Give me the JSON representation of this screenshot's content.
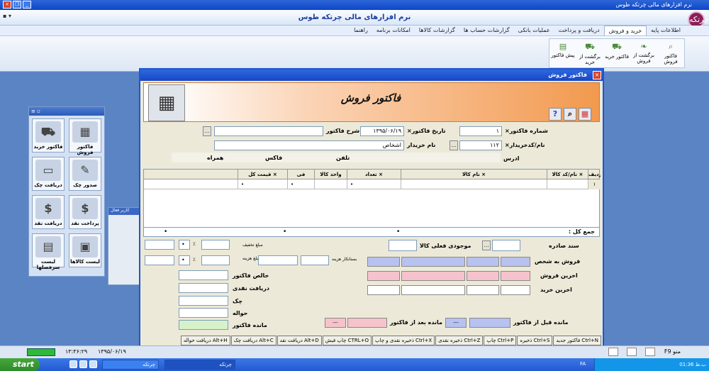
{
  "window": {
    "title": "نرم افزارهای مالی چرتکه طوس",
    "app_title": "نرم افزارهای مالی چرتکه طوس",
    "logo_text": "چرتکه"
  },
  "menu": [
    "اطلاعات پایه",
    "خرید و فروش",
    "دریافت و پرداخت",
    "عملیات بانکی",
    "گزارشات حساب ها",
    "گزارشات کالاها",
    "امکانات برنامه",
    "راهنما"
  ],
  "ribbon": [
    {
      "label": "فاکتور فروش",
      "icon": "search-icon"
    },
    {
      "label": "برگشت از فروش",
      "icon": "leaf-icon"
    },
    {
      "label": "فاکتور خرید",
      "icon": "cart-icon"
    },
    {
      "label": "برگشت از خرید",
      "icon": "cart-icon"
    },
    {
      "label": "پیش فاکتور",
      "icon": "document-icon"
    }
  ],
  "left_panel": {
    "tiles": [
      "فاکتور فروش",
      "فاکتور خرید",
      "صدور چک",
      "دریافت چک",
      "پرداخت نقد",
      "دریافت نقد",
      "لیست کالاها",
      "لیست سرفصلها"
    ]
  },
  "side_dialog_title": "کاربر فعال",
  "dialog": {
    "title": "فاکتور فروش",
    "banner_title": "فاکتور فروش",
    "fields": {
      "invoice_no_label": "شماره فاکتور×",
      "invoice_no": "۱",
      "invoice_date_label": "تاریخ فاکتور×",
      "invoice_date": "۱۳۹۵/۰۶/۱۹",
      "desc_label": "شرح فاکتور",
      "desc": "",
      "customer_label": "نام/کدخریدار×",
      "customer_code": "۱۱۲",
      "buyer_name_label": "نام خریدار",
      "buyer_name": "اشخاص",
      "address_label": "ادرس",
      "phone_label": "تلفن",
      "fax_label": "فاکس",
      "mobile_label": "همراه"
    },
    "grid": {
      "headers": [
        "ردیف",
        "نام/کد کالا ×",
        "نام کالا ×",
        "تعداد ×",
        "واحد کالا",
        "فی",
        "قیمت کل ×"
      ],
      "rows": [
        [
          "۱",
          "",
          "",
          "•",
          "",
          "•",
          "•"
        ]
      ]
    },
    "total_label": "جمع کل :",
    "total_values": [
      "•",
      "•",
      "•"
    ],
    "right_fields": {
      "issued_doc": "سند صادره",
      "stock": "موجودی فعلی کالا",
      "sale_to_person": "فروش به شخص",
      "last_sale": "اخرین فروش",
      "last_purchase": "اخرین خرید",
      "before_balance": "مانده قبل از فاکتور",
      "after_balance": "مانده بعد از فاکتور"
    },
    "dash": "---",
    "left_fields": {
      "discount": "مبلغ تخفیف",
      "cost": "مبلغ هزینه",
      "cost_pct": "بستانکار هزینه",
      "pct": "٪",
      "zero": "•",
      "net": "خالص فاکتور",
      "cash": "دریافت نقدی",
      "check": "چک",
      "transfer": "حواله",
      "balance": "مانده فاکتور"
    }
  },
  "shortcuts": [
    "فاکتور جدید Ctrl+N",
    "ذخیره Ctrl+S",
    "چاپ Ctrl+P",
    "ذخیره نقدی Ctrl+Z",
    "ذخیره نقدی و چاپ Ctrl+X",
    "چاپ فیش CTRL+O",
    "دریافت نقد Alt+D",
    "دریافت چک Alt+C",
    "دریافت حواله Alt+H"
  ],
  "status": {
    "date": "۱۳۹۵/۰۶/۱۹",
    "time": "۱۳:۳۶:۲۹",
    "right": "F9 منو"
  },
  "taskbar": {
    "start": "start",
    "task1": "چرتکه",
    "task2": "چرتکه",
    "lang": "FA",
    "clock": "01:36 ب.ظ"
  }
}
